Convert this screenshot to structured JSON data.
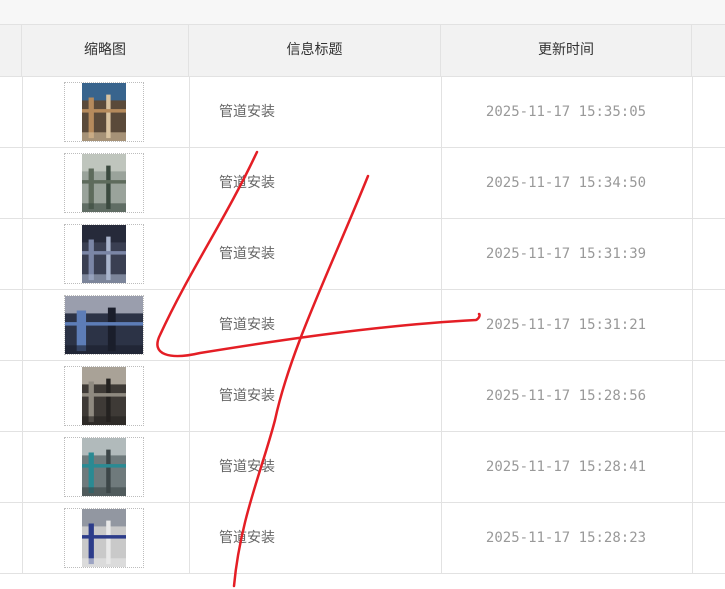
{
  "table": {
    "headers": {
      "thumbnail": "缩略图",
      "title": "信息标题",
      "updated": "更新时间"
    },
    "rows": [
      {
        "title": "管道安装",
        "time": "2025-11-17 15:35:05",
        "orientation": "portrait"
      },
      {
        "title": "管道安装",
        "time": "2025-11-17 15:34:50",
        "orientation": "portrait"
      },
      {
        "title": "管道安装",
        "time": "2025-11-17 15:31:39",
        "orientation": "portrait"
      },
      {
        "title": "管道安装",
        "time": "2025-11-17 15:31:21",
        "orientation": "landscape"
      },
      {
        "title": "管道安装",
        "time": "2025-11-17 15:28:56",
        "orientation": "portrait"
      },
      {
        "title": "管道安装",
        "time": "2025-11-17 15:28:41",
        "orientation": "portrait"
      },
      {
        "title": "管道安装",
        "time": "2025-11-17 15:28:23",
        "orientation": "portrait"
      }
    ]
  },
  "annotation": {
    "color": "#e41e25",
    "shape": "handwritten-4-scribble"
  }
}
